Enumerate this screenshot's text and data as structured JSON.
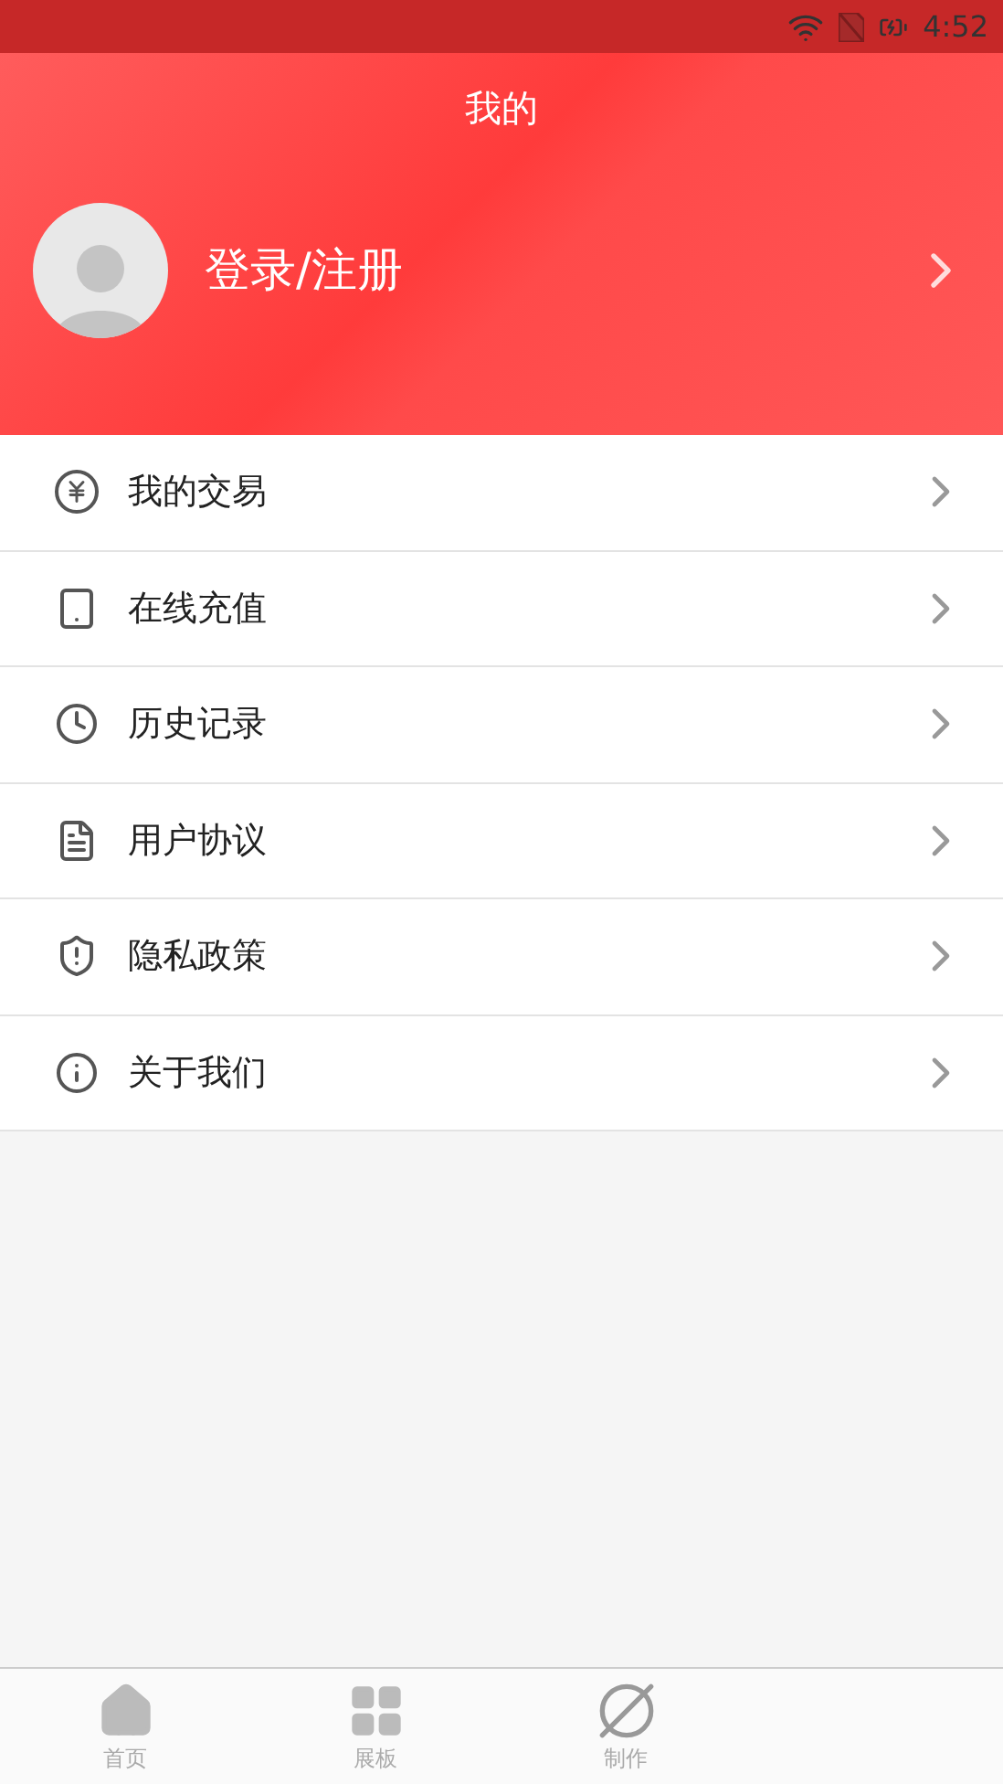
{
  "status_bar": {
    "time": "4:52"
  },
  "header": {
    "title": "我的",
    "login": "登录/注册"
  },
  "menu": [
    {
      "kind": "trade",
      "label": "我的交易"
    },
    {
      "kind": "recharge",
      "label": "在线充值"
    },
    {
      "kind": "history",
      "label": "历史记录"
    },
    {
      "kind": "agreement",
      "label": "用户协议"
    },
    {
      "kind": "privacy",
      "label": "隐私政策"
    },
    {
      "kind": "about",
      "label": "关于我们"
    }
  ],
  "tabs": [
    {
      "kind": "home",
      "label": "首页",
      "selected": false
    },
    {
      "kind": "board",
      "label": "展板",
      "selected": false
    },
    {
      "kind": "make",
      "label": "制作",
      "selected": false
    }
  ]
}
